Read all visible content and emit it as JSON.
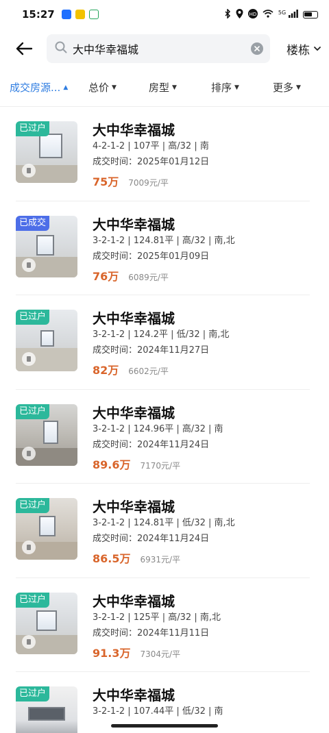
{
  "status_bar": {
    "time": "15:27",
    "network": "5G"
  },
  "search": {
    "value": "大中华幸福城"
  },
  "building_filter": {
    "label": "楼栋"
  },
  "filters": [
    {
      "label": "成交房源...",
      "active": true
    },
    {
      "label": "总价",
      "active": false
    },
    {
      "label": "房型",
      "active": false
    },
    {
      "label": "排序",
      "active": false
    },
    {
      "label": "更多",
      "active": false
    }
  ],
  "listings": [
    {
      "badge": "已过户",
      "badge_color": "teal",
      "title": "大中华幸福城",
      "spec": "4-2-1-2 | 107平 | 高/32 | 南",
      "date": "成交时间：2025年01月12日",
      "price": "75万",
      "unit_price": "7009元/平"
    },
    {
      "badge": "已成交",
      "badge_color": "blue",
      "title": "大中华幸福城",
      "spec": "3-2-1-2 | 124.81平 | 高/32 | 南,北",
      "date": "成交时间：2025年01月09日",
      "price": "76万",
      "unit_price": "6089元/平"
    },
    {
      "badge": "已过户",
      "badge_color": "teal",
      "title": "大中华幸福城",
      "spec": "3-2-1-2 | 124.2平 | 低/32 | 南,北",
      "date": "成交时间：2024年11月27日",
      "price": "82万",
      "unit_price": "6602元/平"
    },
    {
      "badge": "已过户",
      "badge_color": "teal",
      "title": "大中华幸福城",
      "spec": "3-2-1-2 | 124.96平 | 高/32 | 南",
      "date": "成交时间：2024年11月24日",
      "price": "89.6万",
      "unit_price": "7170元/平"
    },
    {
      "badge": "已过户",
      "badge_color": "teal",
      "title": "大中华幸福城",
      "spec": "3-2-1-2 | 124.81平 | 低/32 | 南,北",
      "date": "成交时间：2024年11月24日",
      "price": "86.5万",
      "unit_price": "6931元/平"
    },
    {
      "badge": "已过户",
      "badge_color": "teal",
      "title": "大中华幸福城",
      "spec": "3-2-1-2 | 125平 | 高/32 | 南,北",
      "date": "成交时间：2024年11月11日",
      "price": "91.3万",
      "unit_price": "7304元/平"
    },
    {
      "badge": "已过户",
      "badge_color": "teal",
      "title": "大中华幸福城",
      "spec": "3-2-1-2 | 107.44平 | 低/32 | 南",
      "date": "",
      "price": "",
      "unit_price": ""
    }
  ],
  "colors": {
    "accent": "#2f7de1",
    "price": "#d9652b",
    "badge_teal": "#2cb89b",
    "badge_blue": "#4d6ee8"
  }
}
